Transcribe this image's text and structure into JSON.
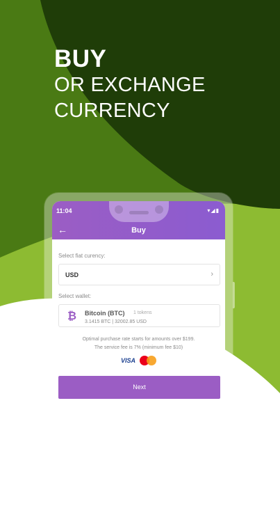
{
  "headline": {
    "line1": "BUY",
    "line2": "OR EXCHANGE",
    "line3": "CURRENCY"
  },
  "status_bar": {
    "time": "11:04",
    "icons": "▾◢▮"
  },
  "app_bar": {
    "title": "Buy",
    "back_icon": "arrow-left"
  },
  "form": {
    "fiat_label": "Select fiat curency:",
    "fiat_value": "USD",
    "wallet_label": "Select wallet:",
    "wallet": {
      "name": "Bitcoin (BTC)",
      "tokens": "1 tokens",
      "balance": "3.1415 BTC | 32002.85 USD",
      "icon": "bitcoin-icon"
    }
  },
  "notes": {
    "line1": "Optimal purchase rate starts for amounts over $199.",
    "line2": "The service fee is 7% (minimum fee $10)"
  },
  "payment": {
    "visa": "VISA",
    "mastercard_colors": [
      "#eb001b",
      "#f79e1b"
    ]
  },
  "next_button": "Next",
  "colors": {
    "accent": "#9b5dc4",
    "bg_green_dark": "#1f3d08",
    "bg_green": "#4a7a14",
    "bg_green_light": "#8dbb32"
  }
}
